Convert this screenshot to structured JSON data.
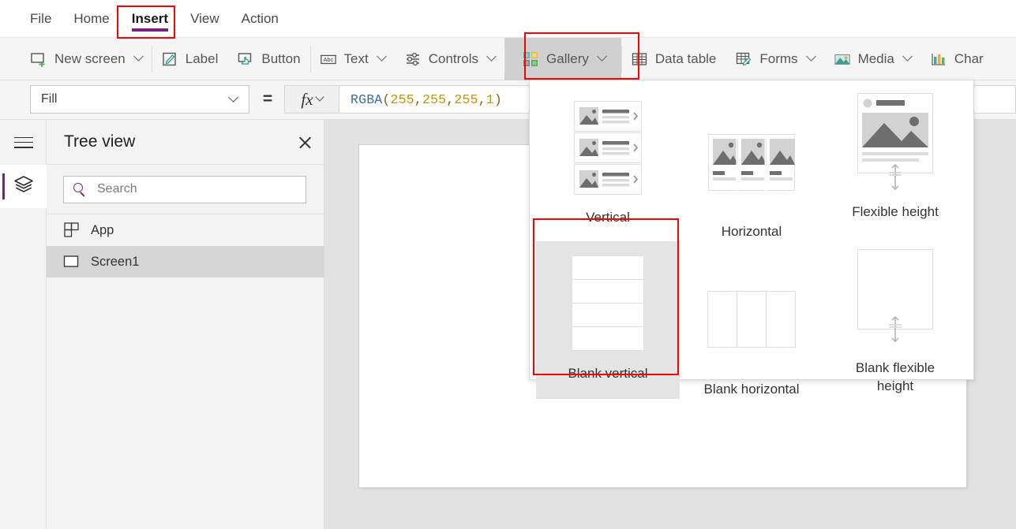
{
  "menu": {
    "items": [
      {
        "label": "File",
        "active": false
      },
      {
        "label": "Home",
        "active": false
      },
      {
        "label": "Insert",
        "active": true
      },
      {
        "label": "View",
        "active": false
      },
      {
        "label": "Action",
        "active": false
      }
    ],
    "active_accent": "#742774"
  },
  "ribbon": {
    "items": [
      {
        "label": "New screen",
        "icon": "new-screen-icon",
        "caret": true,
        "selected": false
      },
      {
        "label": "Label",
        "icon": "label-icon",
        "caret": false,
        "selected": false
      },
      {
        "label": "Button",
        "icon": "button-icon",
        "caret": false,
        "selected": false
      },
      {
        "label": "Text",
        "icon": "text-icon",
        "caret": true,
        "selected": false
      },
      {
        "label": "Controls",
        "icon": "controls-icon",
        "caret": true,
        "selected": false
      },
      {
        "label": "Gallery",
        "icon": "gallery-icon",
        "caret": true,
        "selected": true
      },
      {
        "label": "Data table",
        "icon": "data-table-icon",
        "caret": false,
        "selected": false
      },
      {
        "label": "Forms",
        "icon": "forms-icon",
        "caret": true,
        "selected": false
      },
      {
        "label": "Media",
        "icon": "media-icon",
        "caret": true,
        "selected": false
      },
      {
        "label": "Char",
        "icon": "charts-icon",
        "caret": false,
        "selected": false
      }
    ]
  },
  "formula_bar": {
    "property": "Fill",
    "equals": "=",
    "fx_label": "fx",
    "formula_parts": [
      {
        "text": "RGBA",
        "kind": "fn"
      },
      {
        "text": "(",
        "kind": "paren"
      },
      {
        "text": "255",
        "kind": "num"
      },
      {
        "text": ", ",
        "kind": "comma"
      },
      {
        "text": "255",
        "kind": "num"
      },
      {
        "text": ", ",
        "kind": "comma"
      },
      {
        "text": "255",
        "kind": "num"
      },
      {
        "text": ", ",
        "kind": "comma"
      },
      {
        "text": "1",
        "kind": "num"
      },
      {
        "text": ")",
        "kind": "paren"
      }
    ],
    "formula_text": "RGBA(255, 255, 255, 1)"
  },
  "rail": {
    "hamburger": "menu-icon",
    "active_tool": "tree-view-layers-icon",
    "accent": "#742774"
  },
  "tree_view": {
    "title": "Tree view",
    "close_label": "close-icon",
    "search_placeholder": "Search",
    "search_value": "",
    "rows": [
      {
        "label": "App",
        "icon": "app-icon",
        "selected": false
      },
      {
        "label": "Screen1",
        "icon": "screen-icon",
        "selected": true
      }
    ]
  },
  "gallery_flyout": {
    "cells": [
      {
        "label": "Vertical",
        "thumb": "vertical-gallery-thumb",
        "selected": false
      },
      {
        "label": "Horizontal",
        "thumb": "horizontal-gallery-thumb",
        "selected": false
      },
      {
        "label": "Flexible height",
        "thumb": "flexible-height-gallery-thumb",
        "selected": false
      },
      {
        "label": "Blank vertical",
        "thumb": "blank-vertical-gallery-thumb",
        "selected": true
      },
      {
        "label": "Blank horizontal",
        "thumb": "blank-horizontal-gallery-thumb",
        "selected": false
      },
      {
        "label": "Blank flexible height",
        "thumb": "blank-flexible-height-gallery-thumb",
        "selected": false
      }
    ]
  },
  "annotations": {
    "highlight_color": "#fd0000",
    "boxes": [
      {
        "name": "insert-tab-highlight"
      },
      {
        "name": "gallery-button-highlight"
      },
      {
        "name": "blank-vertical-option-highlight"
      }
    ]
  },
  "canvas": {
    "screen_name": "Screen1",
    "fill": "#ffffff"
  }
}
